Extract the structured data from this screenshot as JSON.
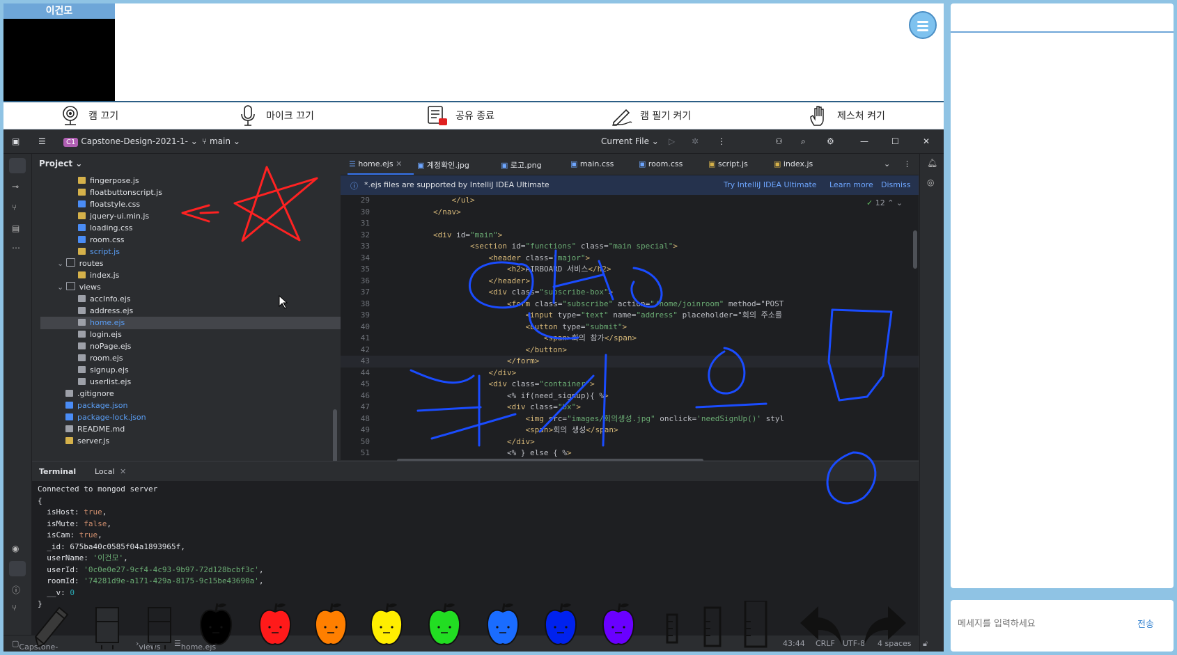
{
  "participant": {
    "name": "이건모"
  },
  "controls": [
    {
      "label": "캠 끄기",
      "icon": "webcam-icon"
    },
    {
      "label": "마이크 끄기",
      "icon": "microphone-icon"
    },
    {
      "label": "공유 종료",
      "icon": "share-stop-icon"
    },
    {
      "label": "캠 필기 켜기",
      "icon": "pen-writing-icon"
    },
    {
      "label": "제스처 켜기",
      "icon": "hand-gesture-icon"
    }
  ],
  "ide": {
    "project_badge": "C1",
    "project_name": "Capstone-Design-2021-1-",
    "branch": "main",
    "run_config": "Current File",
    "project_label": "Project",
    "tree": [
      {
        "name": "fingerpose.js",
        "type": "js"
      },
      {
        "name": "floatbuttonscript.js",
        "type": "js"
      },
      {
        "name": "floatstyle.css",
        "type": "css"
      },
      {
        "name": "jquery-ui.min.js",
        "type": "js"
      },
      {
        "name": "loading.css",
        "type": "css"
      },
      {
        "name": "room.css",
        "type": "css"
      },
      {
        "name": "script.js",
        "type": "js"
      },
      {
        "name": "routes",
        "type": "folder"
      },
      {
        "name": "index.js",
        "type": "js"
      },
      {
        "name": "views",
        "type": "folder"
      },
      {
        "name": "accInfo.ejs",
        "type": "ejs"
      },
      {
        "name": "address.ejs",
        "type": "ejs"
      },
      {
        "name": "home.ejs",
        "type": "ejs"
      },
      {
        "name": "login.ejs",
        "type": "ejs"
      },
      {
        "name": "noPage.ejs",
        "type": "ejs"
      },
      {
        "name": "room.ejs",
        "type": "ejs"
      },
      {
        "name": "signup.ejs",
        "type": "ejs"
      },
      {
        "name": "userlist.ejs",
        "type": "ejs"
      },
      {
        "name": ".gitignore",
        "type": "ignore"
      },
      {
        "name": "package.json",
        "type": "json"
      },
      {
        "name": "package-lock.json",
        "type": "json"
      },
      {
        "name": "README.md",
        "type": "md"
      },
      {
        "name": "server.js",
        "type": "js"
      }
    ],
    "tabs": [
      "home.ejs",
      "계정확인.jpg",
      "로고.png",
      "main.css",
      "room.css",
      "script.js",
      "index.js"
    ],
    "banner": {
      "message": "*.ejs files are supported by IntelliJ IDEA Ultimate",
      "try": "Try IntelliJ IDEA Ultimate",
      "learn": "Learn more",
      "dismiss": "Dismiss"
    },
    "check_count": "12",
    "code_lines": [
      {
        "n": "29",
        "t": "            </ul>"
      },
      {
        "n": "30",
        "t": "        </nav>"
      },
      {
        "n": "31",
        "t": ""
      },
      {
        "n": "32",
        "t": "        <div id=\"main\">"
      },
      {
        "n": "33",
        "t": "                <section id=\"functions\" class=\"main special\">"
      },
      {
        "n": "34",
        "t": "                    <header class=\"major\">"
      },
      {
        "n": "35",
        "t": "                        <h2>AIRBOARD 서비스</h2>"
      },
      {
        "n": "36",
        "t": "                    </header>"
      },
      {
        "n": "37",
        "t": "                    <div class=\"subscribe-box\">"
      },
      {
        "n": "38",
        "t": "                        <form class=\"subscribe\" action=\"/home/joinroom\" method=\"POST"
      },
      {
        "n": "39",
        "t": "                            <input type=\"text\" name=\"address\" placeholder=\"회의 주소를"
      },
      {
        "n": "40",
        "t": "                            <button type=\"submit\">"
      },
      {
        "n": "41",
        "t": "                                <span>회의 참가</span>"
      },
      {
        "n": "42",
        "t": "                            </button>"
      },
      {
        "n": "43",
        "t": "                        </form>"
      },
      {
        "n": "44",
        "t": "                    </div>"
      },
      {
        "n": "45",
        "t": "                    <div class=\"container\">"
      },
      {
        "n": "46",
        "t": "                        <% if(need_signup){ %>"
      },
      {
        "n": "47",
        "t": "                        <div class=\"bx\">"
      },
      {
        "n": "48",
        "t": "                            <img src=\"images/회의생성.jpg\" onclick='needSignUp()' styl"
      },
      {
        "n": "49",
        "t": "                            <span>회의 생성</span>"
      },
      {
        "n": "50",
        "t": "                        </div>"
      },
      {
        "n": "51",
        "t": "                        <% } else { %>"
      }
    ],
    "terminal": {
      "tab_label": "Terminal",
      "local_label": "Local",
      "line1": "Connected to mongod server",
      "open": "{",
      "fields": [
        {
          "k": "  isHost: ",
          "v": "true",
          "c": "orange"
        },
        {
          "k": "  isMute: ",
          "v": "false",
          "c": "orange"
        },
        {
          "k": "  isCam: ",
          "v": "true",
          "c": "orange"
        },
        {
          "k": "  _id: ",
          "v": "675ba40c0585f04a1893965f",
          "c": "kv"
        },
        {
          "k": "  userName: ",
          "v": "'이건모'",
          "c": "green"
        },
        {
          "k": "  userId: ",
          "v": "'0c0e0e27-9cf4-4c93-9b97-72d128bcbf3c'",
          "c": "green"
        },
        {
          "k": "  roomId: ",
          "v": "'74281d9e-a171-429a-8175-9c15be43690a'",
          "c": "green"
        },
        {
          "k": "  __v: ",
          "v": "0",
          "c": "num"
        }
      ],
      "close": "}"
    },
    "status": {
      "project": "Capstone-Design-2021",
      "folder": "views",
      "file": "home.ejs",
      "position": "43:44",
      "line_sep": "CRLF",
      "encoding": "UTF-8",
      "indent": "4 spaces"
    }
  },
  "whiteboard_tools": [
    "pen",
    "eraser",
    "eraser-outline",
    "black",
    "red",
    "orange",
    "yellow",
    "green",
    "blue",
    "navy",
    "purple",
    "thin",
    "medium",
    "thick",
    "undo",
    "redo"
  ],
  "colors": {
    "black": "#000000",
    "red": "#ff1a1a",
    "orange": "#ff7f00",
    "yellow": "#ffee00",
    "green": "#22dd22",
    "blue": "#1a6cff",
    "navy": "#0022ee",
    "purple": "#6a00ff"
  },
  "chat": {
    "placeholder": "메세지를 입력하세요",
    "send": "전송"
  }
}
